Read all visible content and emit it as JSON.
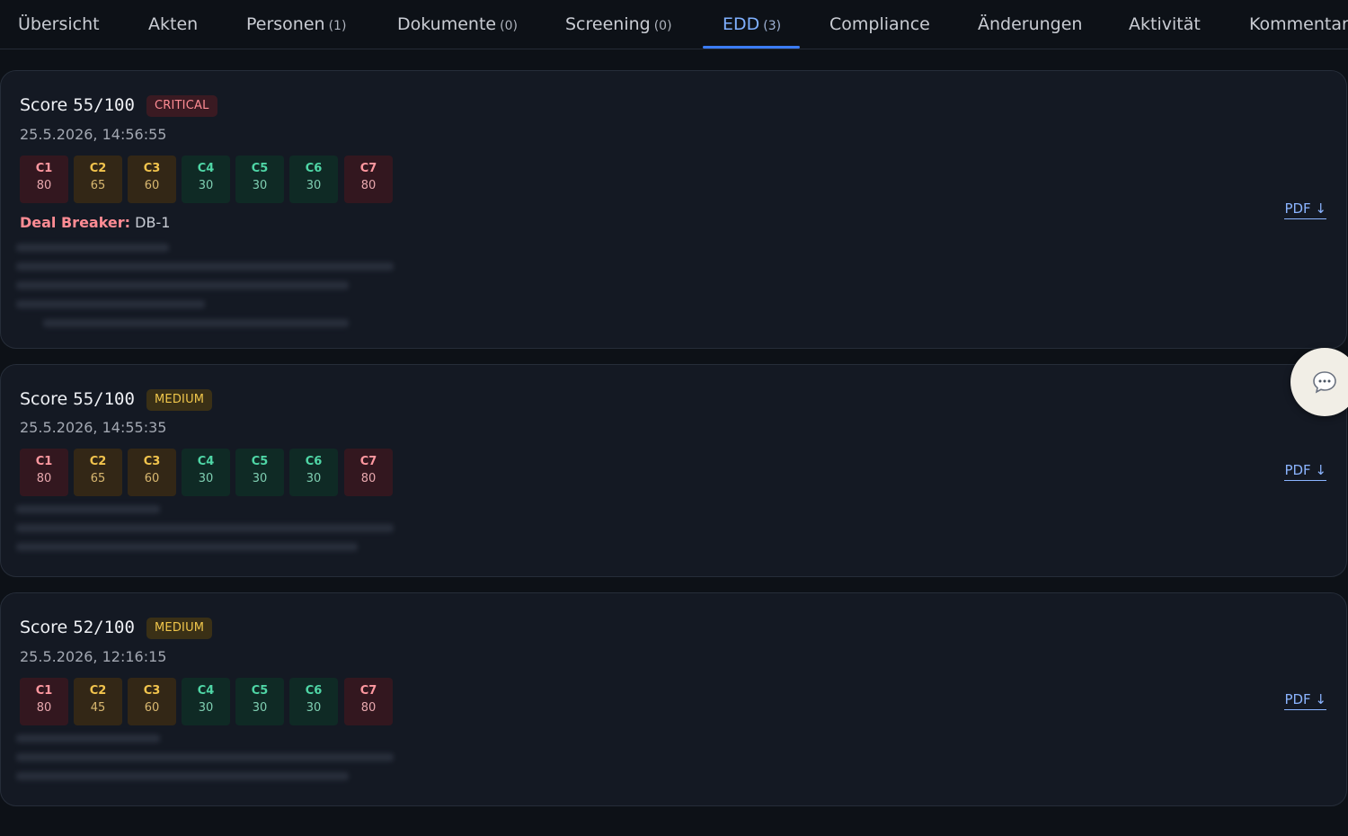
{
  "tabs": [
    {
      "label": "Übersicht",
      "count": ""
    },
    {
      "label": "Akten",
      "count": ""
    },
    {
      "label": "Personen",
      "count": "(1)"
    },
    {
      "label": "Dokumente",
      "count": "(0)"
    },
    {
      "label": "Screening",
      "count": "(0)"
    },
    {
      "label": "EDD",
      "count": "(3)",
      "active": true
    },
    {
      "label": "Compliance",
      "count": ""
    },
    {
      "label": "Änderungen",
      "count": ""
    },
    {
      "label": "Aktivität",
      "count": ""
    },
    {
      "label": "Kommentare",
      "count": ""
    }
  ],
  "entries": [
    {
      "score_label": "Score",
      "score": "55/100",
      "level": "CRITICAL",
      "timestamp": "25.5.2026, 14:56:55",
      "categories": [
        {
          "name": "C1",
          "value": "80",
          "color": "red"
        },
        {
          "name": "C2",
          "value": "65",
          "color": "amber"
        },
        {
          "name": "C3",
          "value": "60",
          "color": "amber"
        },
        {
          "name": "C4",
          "value": "30",
          "color": "green"
        },
        {
          "name": "C5",
          "value": "30",
          "color": "green"
        },
        {
          "name": "C6",
          "value": "30",
          "color": "green"
        },
        {
          "name": "C7",
          "value": "80",
          "color": "red"
        }
      ],
      "deal_breaker_label": "Deal Breaker:",
      "deal_breaker_value": "DB-1",
      "pdf_label": "PDF ↓"
    },
    {
      "score_label": "Score",
      "score": "55/100",
      "level": "MEDIUM",
      "timestamp": "25.5.2026, 14:55:35",
      "categories": [
        {
          "name": "C1",
          "value": "80",
          "color": "red"
        },
        {
          "name": "C2",
          "value": "65",
          "color": "amber"
        },
        {
          "name": "C3",
          "value": "60",
          "color": "amber"
        },
        {
          "name": "C4",
          "value": "30",
          "color": "green"
        },
        {
          "name": "C5",
          "value": "30",
          "color": "green"
        },
        {
          "name": "C6",
          "value": "30",
          "color": "green"
        },
        {
          "name": "C7",
          "value": "80",
          "color": "red"
        }
      ],
      "pdf_label": "PDF ↓"
    },
    {
      "score_label": "Score",
      "score": "52/100",
      "level": "MEDIUM",
      "timestamp": "25.5.2026, 12:16:15",
      "categories": [
        {
          "name": "C1",
          "value": "80",
          "color": "red"
        },
        {
          "name": "C2",
          "value": "45",
          "color": "amber"
        },
        {
          "name": "C3",
          "value": "60",
          "color": "amber"
        },
        {
          "name": "C4",
          "value": "30",
          "color": "green"
        },
        {
          "name": "C5",
          "value": "30",
          "color": "green"
        },
        {
          "name": "C6",
          "value": "30",
          "color": "green"
        },
        {
          "name": "C7",
          "value": "80",
          "color": "red"
        }
      ],
      "pdf_label": "PDF ↓"
    }
  ],
  "colors": {
    "accent": "#3b7cf5",
    "critical": "#ff8c94",
    "medium": "#f0c64b",
    "low": "#4fd6a6"
  },
  "chat_icon": "chat-bubble-icon"
}
